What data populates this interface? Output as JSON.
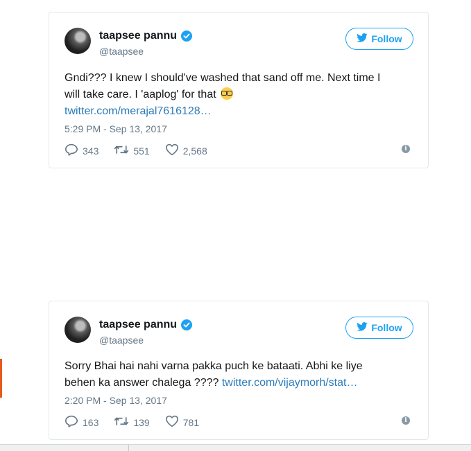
{
  "tweets": [
    {
      "name": "taapsee pannu",
      "handle": "@taapsee",
      "follow_label": "Follow",
      "text_line1": "Gndi??? I knew I should've washed that sand off me. Next time I",
      "text_line2": "will take care. I 'aaplog' for that ",
      "link": "twitter.com/merajal7616128…",
      "timestamp": "5:29 PM - Sep 13, 2017",
      "replies": "343",
      "retweets": "551",
      "likes": "2,568"
    },
    {
      "name": "taapsee pannu",
      "handle": "@taapsee",
      "follow_label": "Follow",
      "text_line1": "Sorry Bhai hai nahi varna pakka puch ke bataati. Abhi ke liye",
      "text_line2": "behen ka answer chalega ???? ",
      "link": "twitter.com/vijaymorh/stat…",
      "timestamp": "2:20 PM - Sep 13, 2017",
      "replies": "163",
      "retweets": "139",
      "likes": "781"
    }
  ],
  "icons": {
    "reply": "reply-icon",
    "retweet": "retweet-icon",
    "like": "heart-icon",
    "info": "info-icon",
    "verified": "verified-badge-icon",
    "bird": "twitter-bird-icon",
    "emoji": "nerd-face-emoji-icon"
  },
  "colors": {
    "accent": "#1da1f2",
    "link": "#2b7bb9",
    "muted": "#657786",
    "border": "#e1e8ed"
  }
}
